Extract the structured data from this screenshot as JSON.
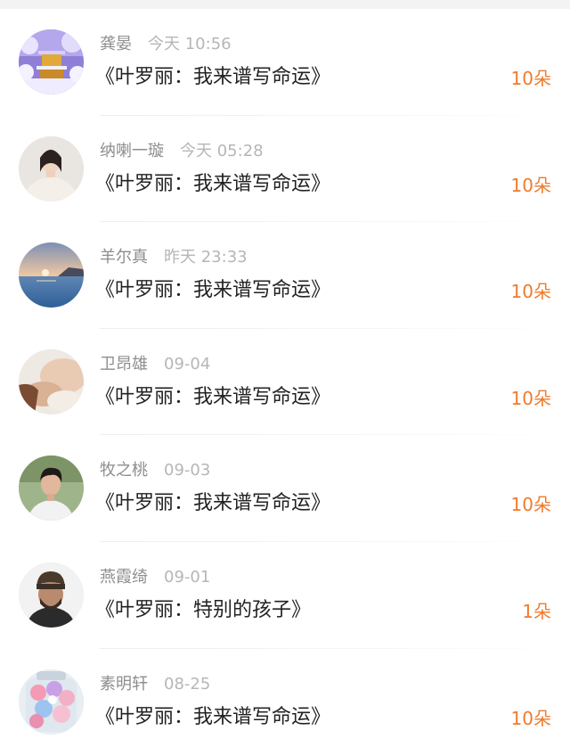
{
  "records": [
    {
      "name": "龚晏",
      "time": "今天 10:56",
      "title": "《叶罗丽：我来谱写命运》",
      "count": "10朵",
      "avatar": "snow-temple-avatar"
    },
    {
      "name": "纳喇一璇",
      "time": "今天 05:28",
      "title": "《叶罗丽：我来谱写命运》",
      "count": "10朵",
      "avatar": "woman-portrait-avatar"
    },
    {
      "name": "羊尔真",
      "time": "昨天 23:33",
      "title": "《叶罗丽：我来谱写命运》",
      "count": "10朵",
      "avatar": "sunset-sea-avatar"
    },
    {
      "name": "卫昂雄",
      "time": "09-04",
      "title": "《叶罗丽：我来谱写命运》",
      "count": "10朵",
      "avatar": "hands-avatar"
    },
    {
      "name": "牧之桃",
      "time": "09-03",
      "title": "《叶罗丽：我来谱写命运》",
      "count": "10朵",
      "avatar": "young-man-avatar"
    },
    {
      "name": "燕霞绮",
      "time": "09-01",
      "title": "《叶罗丽：特别的孩子》",
      "count": "1朵",
      "avatar": "bearded-man-avatar"
    },
    {
      "name": "素明轩",
      "time": "08-25",
      "title": "《叶罗丽：我来谱写命运》",
      "count": "10朵",
      "avatar": "flower-jar-avatar"
    }
  ],
  "colors": {
    "accent_count": "#f07a2c",
    "name_text": "#8e8e8e",
    "time_text": "#b6b6b6",
    "title_text": "#222222"
  }
}
